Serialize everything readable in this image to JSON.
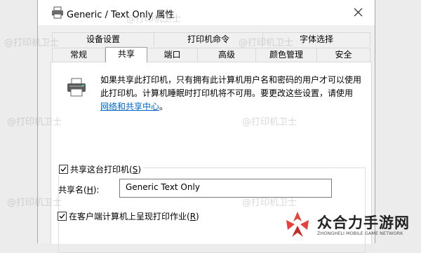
{
  "window": {
    "title": "Generic / Text Only 属性",
    "close_glyph": "close-icon"
  },
  "tabs_row1": [
    {
      "label": "设备设置"
    },
    {
      "label": "打印机命令"
    },
    {
      "label": "字体选择"
    }
  ],
  "tabs_row2": [
    {
      "label": "常规"
    },
    {
      "label": "共享",
      "active": true
    },
    {
      "label": "端口"
    },
    {
      "label": "高级"
    },
    {
      "label": "颜色管理"
    },
    {
      "label": "安全"
    }
  ],
  "sharing": {
    "info_text": "如果共享此打印机，只有拥有此计算机用户名和密码的用户才可以使用此打印机。计算机睡眠时打印机将不可用。要更改这些设置，请使用",
    "link_text": "网络和共享中心",
    "link_suffix": "。",
    "share_checkbox_label": "共享这台打印机(",
    "share_checkbox_accel": "S",
    "share_checkbox_close": ")",
    "share_checked": true,
    "share_name_label": "共享名(",
    "share_name_accel": "H",
    "share_name_close": "):",
    "share_name_value": "Generic  Text Only",
    "render_checkbox_label": "在客户端计算机上呈现打印作业(",
    "render_checkbox_accel": "R",
    "render_checkbox_close": ")",
    "render_checked": true
  },
  "watermark": "@打印机卫士",
  "brand": {
    "name": "众合力手游网",
    "sub": "ZHONGHELI MOBILE GAME NETWORK"
  },
  "colors": {
    "link": "#0066cc",
    "brand_red": "#e8403a"
  }
}
